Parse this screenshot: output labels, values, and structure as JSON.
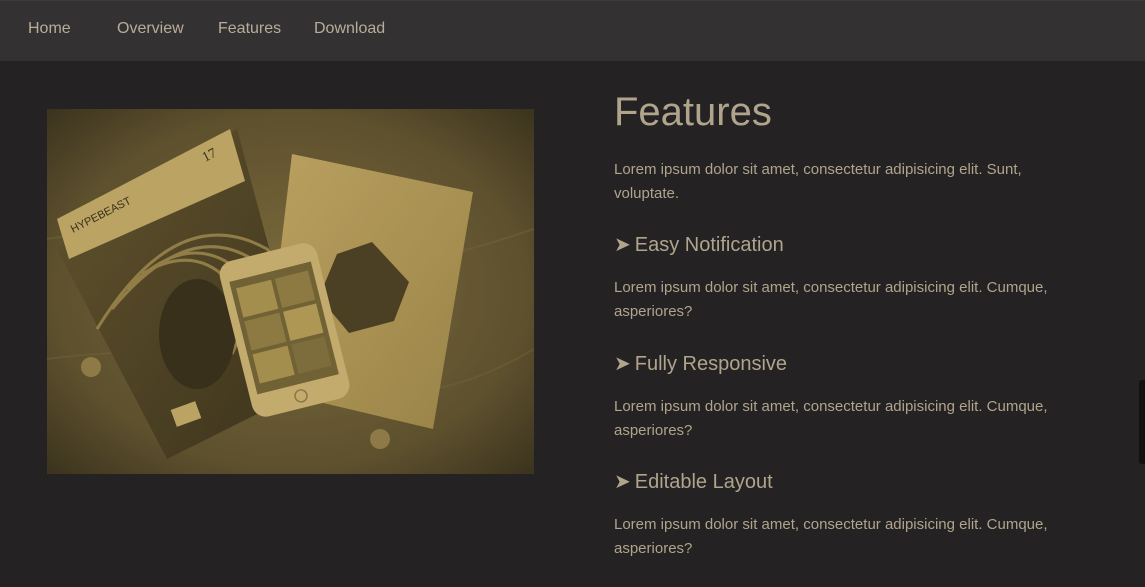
{
  "nav": {
    "items": [
      {
        "label": "Home"
      },
      {
        "label": "Overview"
      },
      {
        "label": "Features"
      },
      {
        "label": "Download"
      }
    ]
  },
  "photo": {
    "magazine_title": "HYPEBEAST",
    "magazine_issue": "17"
  },
  "features": {
    "title": "Features",
    "intro": "Lorem ipsum dolor sit amet, consectetur adipisicing elit. Sunt, voluptate.",
    "arrow_icon": "➤",
    "items": [
      {
        "heading": "Easy Notification",
        "text": "Lorem ipsum dolor sit amet, consectetur adipisicing elit. Cumque, asperiores?"
      },
      {
        "heading": "Fully Responsive",
        "text": "Lorem ipsum dolor sit amet, consectetur adipisicing elit. Cumque, asperiores?"
      },
      {
        "heading": "Editable Layout",
        "text": "Lorem ipsum dolor sit amet, consectetur adipisicing elit. Cumque, asperiores?"
      }
    ]
  },
  "colors": {
    "nav_bg": "#333132",
    "page_bg": "#242223",
    "text": "#b0a48d",
    "photo_tint": "#8a7640"
  }
}
